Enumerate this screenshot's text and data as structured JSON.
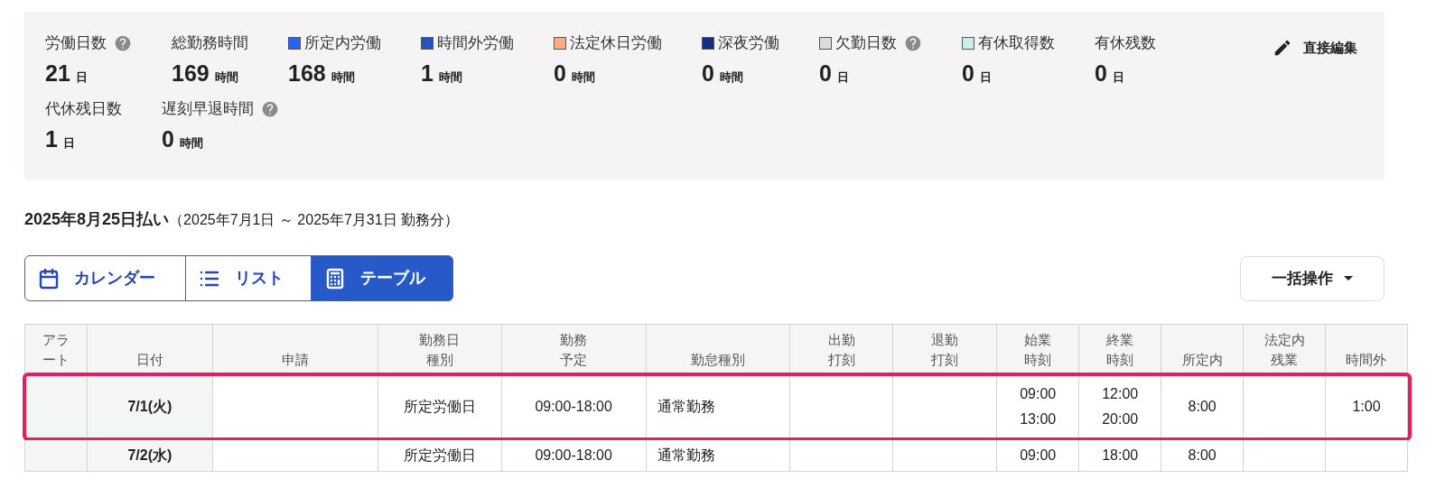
{
  "summary": {
    "rows": [
      [
        {
          "label": "労働日数",
          "value": "21",
          "unit": "日",
          "help": true
        },
        {
          "label": "総勤務時間",
          "value": "169",
          "unit": "時間",
          "help": false
        },
        {
          "label": "所定内労働",
          "value": "168",
          "unit": "時間",
          "help": false,
          "color": "#2962f0"
        },
        {
          "label": "時間外労働",
          "value": "1",
          "unit": "時間",
          "help": false,
          "color": "#2552c4"
        },
        {
          "label": "法定休日労働",
          "value": "0",
          "unit": "時間",
          "help": false,
          "color": "#fdad7f"
        },
        {
          "label": "深夜労働",
          "value": "0",
          "unit": "時間",
          "help": false,
          "color": "#142f82"
        },
        {
          "label": "欠勤日数",
          "value": "0",
          "unit": "日",
          "help": true,
          "color": "#dcdadb"
        },
        {
          "label": "有休取得数",
          "value": "0",
          "unit": "日",
          "help": false,
          "color": "#c9eeee"
        },
        {
          "label": "有休残数",
          "value": "0",
          "unit": "日",
          "help": false
        }
      ],
      [
        {
          "label": "代休残日数",
          "value": "1",
          "unit": "日",
          "help": false
        },
        {
          "label": "遅刻早退時間",
          "value": "0",
          "unit": "時間",
          "help": true
        }
      ]
    ],
    "edit_button": "直接編集"
  },
  "period": {
    "title": "2025年8月25日払い",
    "range": "（2025年7月1日 ～ 2025年7月31日 勤務分）"
  },
  "view_tabs": [
    {
      "kind": "calendar",
      "label": "カレンダー",
      "selected": false
    },
    {
      "kind": "list",
      "label": "リスト",
      "selected": false
    },
    {
      "kind": "table",
      "label": "テーブル",
      "selected": true
    }
  ],
  "bulk_button": "一括操作",
  "table": {
    "columns": [
      "アラート",
      "日付",
      "申請",
      "勤務日種別",
      "勤務予定",
      "勤怠種別",
      "出勤打刻",
      "退勤打刻",
      "始業時刻",
      "終業時刻",
      "所定内",
      "法定内残業",
      "時間外"
    ],
    "rows": [
      {
        "highlighted": true,
        "cells": [
          "",
          "7/1(火)",
          "",
          "所定労働日",
          "09:00-18:00",
          "通常勤務",
          "",
          "",
          "09:00 13:00",
          "12:00 20:00",
          "8:00",
          "",
          "1:00"
        ]
      },
      {
        "highlighted": false,
        "cells": [
          "",
          "7/2(水)",
          "",
          "所定労働日",
          "09:00-18:00",
          "通常勤務",
          "",
          "",
          "09:00",
          "18:00",
          "8:00",
          "",
          ""
        ]
      }
    ]
  }
}
